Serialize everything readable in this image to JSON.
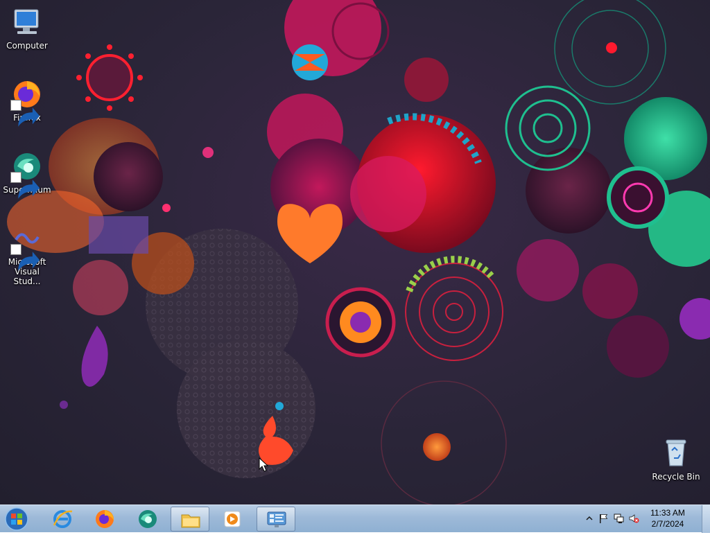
{
  "desktop": {
    "icons": [
      {
        "label": "Computer",
        "icon": "computer-icon"
      },
      {
        "label": "Firefox",
        "icon": "firefox-icon"
      },
      {
        "label": "Supermium",
        "icon": "supermium-icon"
      },
      {
        "label": "Microsoft Visual Stud...",
        "icon": "visual-studio-icon"
      },
      {
        "label": "Recycle Bin",
        "icon": "recycle-bin-icon"
      }
    ]
  },
  "taskbar": {
    "start": {
      "icon": "windows-start-icon"
    },
    "pinned": [
      {
        "icon": "internet-explorer-icon",
        "active": false
      },
      {
        "icon": "firefox-icon",
        "active": false
      },
      {
        "icon": "supermium-icon",
        "active": false
      },
      {
        "icon": "file-explorer-icon",
        "active": true
      },
      {
        "icon": "media-player-icon",
        "active": false
      },
      {
        "icon": "control-panel-icon",
        "active": true
      }
    ],
    "tray": {
      "icons": [
        "show-hidden-icons-chevron",
        "action-center-flag-icon",
        "network-icon",
        "volume-muted-icon"
      ],
      "time": "11:33 AM",
      "date": "2/7/2024"
    }
  },
  "colors": {
    "taskbar": "#9db9d8",
    "accent_magenta": "#d81b60",
    "accent_teal": "#1fbf8f",
    "wallpaper_base": "#2a2538"
  }
}
